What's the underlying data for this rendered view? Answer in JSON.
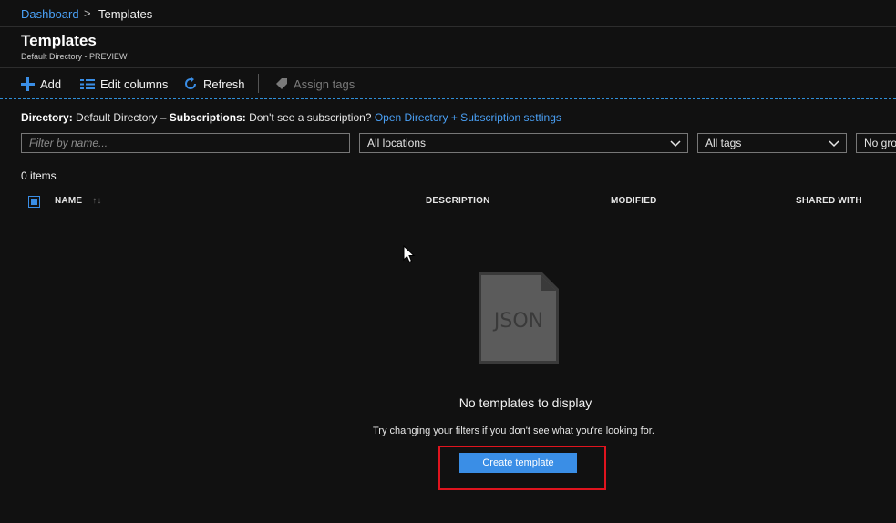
{
  "breadcrumb": {
    "home": "Dashboard",
    "separator": ">",
    "current": "Templates"
  },
  "header": {
    "title": "Templates",
    "subtitle": "Default Directory - PREVIEW"
  },
  "toolbar": {
    "add": "Add",
    "edit_columns": "Edit columns",
    "refresh": "Refresh",
    "assign_tags": "Assign tags"
  },
  "directory_line": {
    "directory_label": "Directory:",
    "directory_value": "Default Directory – ",
    "subscriptions_label": "Subscriptions:",
    "subscriptions_value": "Don't see a subscription?",
    "link": "Open Directory + Subscription settings"
  },
  "filters": {
    "name_placeholder": "Filter by name...",
    "locations": "All locations",
    "tags": "All tags",
    "grouping": "No gro"
  },
  "items_count": "0 items",
  "columns": {
    "name": "NAME",
    "description": "DESCRIPTION",
    "modified": "MODIFIED",
    "shared_with": "SHARED WITH"
  },
  "empty_state": {
    "icon_text": "JSON",
    "title": "No templates to display",
    "subtitle": "Try changing your filters if you don't see what you're looking for.",
    "button": "Create template"
  },
  "colors": {
    "background": "#111111",
    "link": "#4aa0f5",
    "accent": "#3a8ee6",
    "highlight": "#e0141e"
  }
}
